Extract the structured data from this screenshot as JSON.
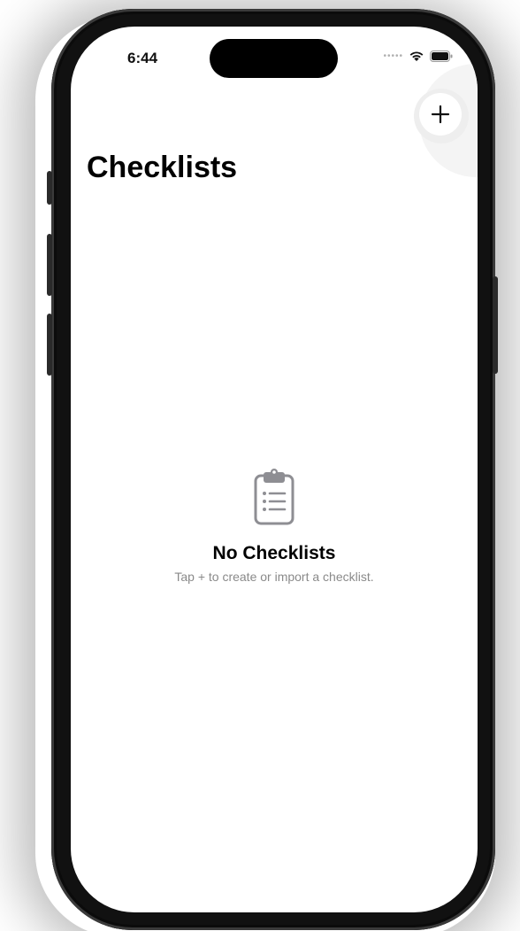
{
  "status_bar": {
    "time": "6:44",
    "signal_icon": "signal-dots-icon",
    "wifi_icon": "wifi-icon",
    "battery_icon": "battery-icon"
  },
  "header": {
    "title": "Checklists",
    "add_button_label": "+",
    "add_icon": "plus-icon"
  },
  "empty_state": {
    "icon": "clipboard-list-icon",
    "title": "No Checklists",
    "subtitle": "Tap + to create or import a checklist."
  },
  "colors": {
    "background": "#ffffff",
    "text_primary": "#000000",
    "text_secondary": "#8a8a8a",
    "icon_gray": "#8e8e93"
  }
}
